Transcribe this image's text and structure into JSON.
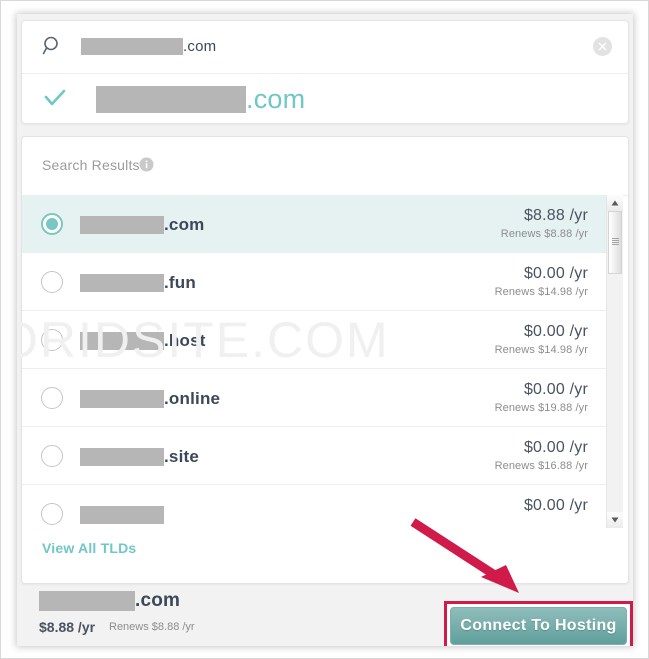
{
  "search": {
    "icon": "search-icon",
    "value_suffix": ".com",
    "clear_icon": "close-circle-icon"
  },
  "suggestion": {
    "check_icon": "check-icon",
    "value_suffix": ".com"
  },
  "results": {
    "title": "Search Results",
    "info_icon": "info-icon",
    "rows": [
      {
        "tld": ".com",
        "price": "$8.88 /yr",
        "renews": "Renews $8.88 /yr",
        "selected": true
      },
      {
        "tld": ".fun",
        "price": "$0.00 /yr",
        "renews": "Renews $14.98 /yr",
        "selected": false
      },
      {
        "tld": ".host",
        "price": "$0.00 /yr",
        "renews": "Renews $14.98 /yr",
        "selected": false
      },
      {
        "tld": ".online",
        "price": "$0.00 /yr",
        "renews": "Renews $19.88 /yr",
        "selected": false
      },
      {
        "tld": ".site",
        "price": "$0.00 /yr",
        "renews": "Renews $16.88 /yr",
        "selected": false
      },
      {
        "tld": "",
        "price": "$0.00 /yr",
        "renews": "",
        "selected": false
      }
    ],
    "view_all_label": "View All TLDs"
  },
  "footer": {
    "domain_suffix": ".com",
    "price": "$8.88 /yr",
    "renews": "Renews $8.88 /yr",
    "connect_label": "Connect To Hosting"
  },
  "scrollbar": {
    "up_icon": "caret-up-icon",
    "down_icon": "caret-down-icon",
    "thumb": "scroll-thumb"
  },
  "annotation": {
    "arrow_icon": "red-arrow-icon",
    "arrow_color": "#d01b4a",
    "highlight_color": "#d01b4a"
  },
  "watermark": {
    "text": "ORIDSITE.COM"
  },
  "colors": {
    "accent_teal": "#6fc7c6",
    "selected_row_bg": "#e5f2f1",
    "text_dark": "#3c4858",
    "text_muted": "#8d8d8d"
  }
}
